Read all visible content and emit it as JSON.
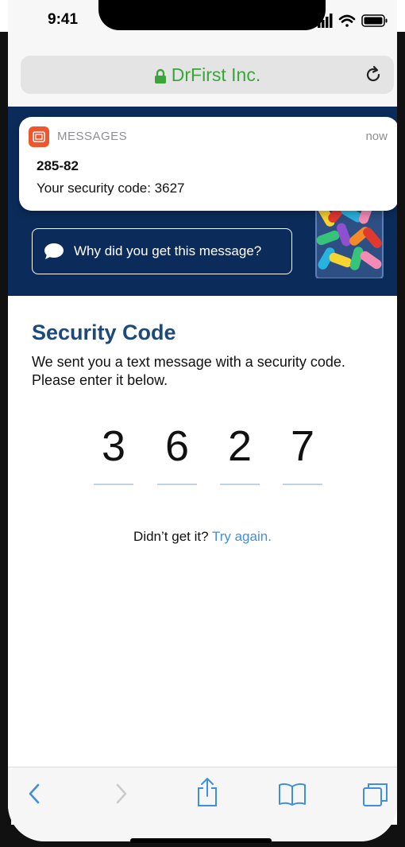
{
  "status": {
    "time": "9:41"
  },
  "browser": {
    "url_label": "DrFirst Inc.",
    "icons": [
      "lock-icon",
      "reload-icon"
    ],
    "url_color": "#3aa63a"
  },
  "notification": {
    "app_name": "MESSAGES",
    "time": "now",
    "title": "285-82",
    "body": "Your security code: 3627"
  },
  "banner": {
    "why_label": "Why did you get this message?",
    "bg_color": "#0b2c5b"
  },
  "content": {
    "heading": "Security Code",
    "description": "We sent you a text message with a security code. Please enter it below.",
    "code_digits": [
      "3",
      "6",
      "2",
      "7"
    ],
    "resend_prompt": "Didn’t get it?",
    "resend_link": "Try again.",
    "link_color": "#3f8fe0"
  },
  "toolbar": {
    "icons": [
      "back-icon",
      "forward-icon",
      "share-icon",
      "bookmarks-icon",
      "tabs-icon"
    ]
  }
}
